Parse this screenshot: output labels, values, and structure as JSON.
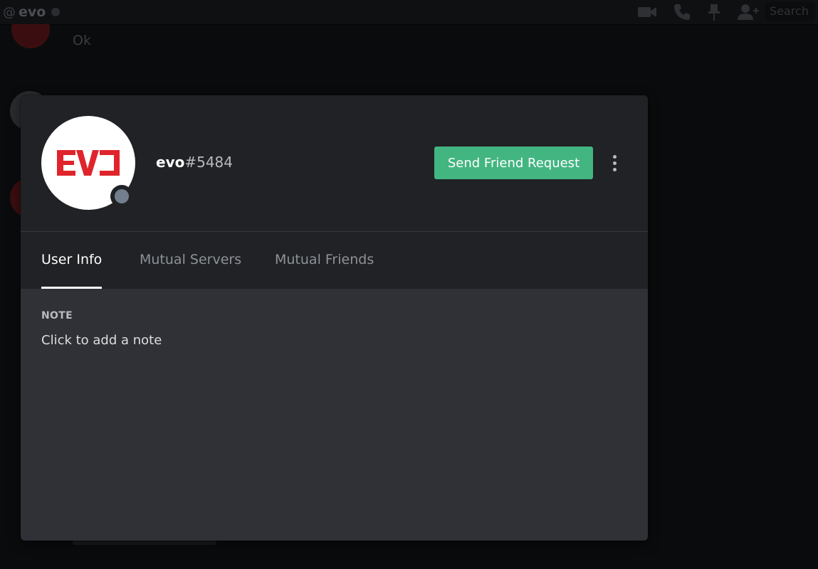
{
  "background": {
    "channel_prefix": "@",
    "channel_name": "evo",
    "search_placeholder": "Search",
    "message_text": "Ok",
    "icons": [
      "video-camera-icon",
      "phone-icon",
      "pin-icon",
      "add-friend-icon"
    ]
  },
  "profile": {
    "username": "evo",
    "discriminator": "#5484",
    "avatar_text": "EVO",
    "status": "offline",
    "colors": {
      "friend_button": "#43b581",
      "avatar_logo": "#e0242b",
      "status_offline": "#747f8d"
    }
  },
  "actions": {
    "send_friend_request": "Send Friend Request",
    "more_icon": "more-vertical-icon"
  },
  "tabs": [
    {
      "label": "User Info",
      "active": true
    },
    {
      "label": "Mutual Servers",
      "active": false
    },
    {
      "label": "Mutual Friends",
      "active": false
    }
  ],
  "note": {
    "label": "NOTE",
    "placeholder": "Click to add a note"
  }
}
